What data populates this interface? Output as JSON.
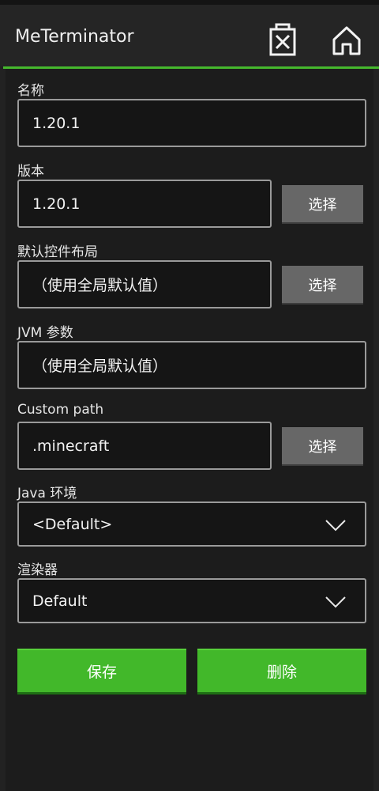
{
  "app": {
    "title": "MeTerminator"
  },
  "form": {
    "name": {
      "label": "名称",
      "value": "1.20.1"
    },
    "version": {
      "label": "版本",
      "value": "1.20.1",
      "button": "选择"
    },
    "control_layout": {
      "label": "默认控件布局",
      "value": "（使用全局默认值）",
      "button": "选择"
    },
    "jvm_args": {
      "label": "JVM 参数",
      "value": "（使用全局默认值）"
    },
    "custom_path": {
      "label": "Custom path",
      "value": ".minecraft",
      "button": "选择"
    },
    "java_env": {
      "label": "Java 环境",
      "value": "<Default>"
    },
    "renderer": {
      "label": "渲染器",
      "value": "Default"
    }
  },
  "actions": {
    "save": "保存",
    "delete": "删除"
  },
  "colors": {
    "accent": "#46b82d",
    "button_green": "#42b82a",
    "button_gray": "#676767",
    "background": "#1c1c1c"
  },
  "icons": {
    "delete": "close-box-icon",
    "home": "home-icon",
    "dropdown": "chevron-down-icon"
  }
}
